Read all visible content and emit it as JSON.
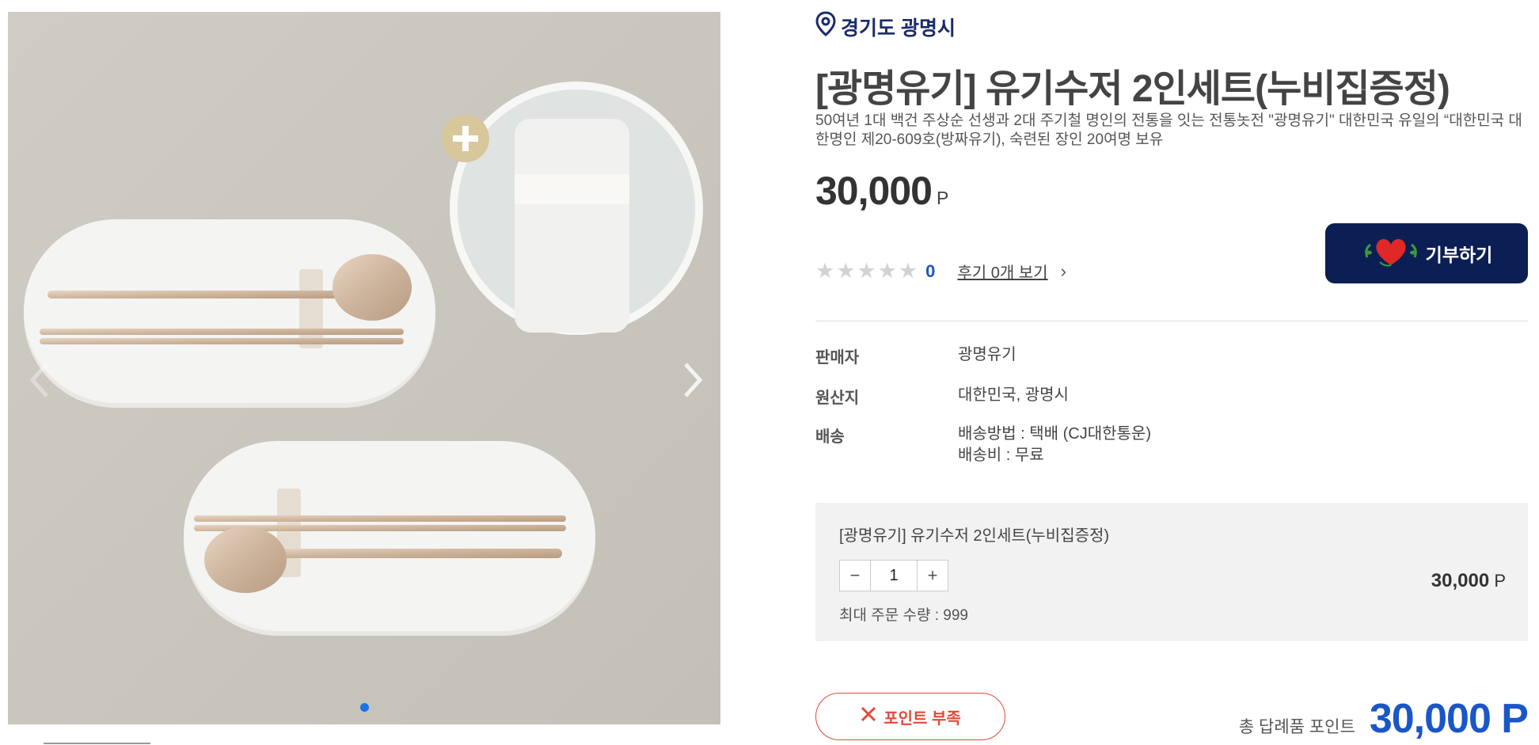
{
  "location": {
    "text": "경기도 광명시",
    "icon": "map-pin-icon"
  },
  "product": {
    "title": "[광명유기] 유기수저 2인세트(누비집증정)",
    "description": "50여년 1대 백건 주상순 선생과 2대 주기철 명인의 전통을 잇는 전통놋전 \"광명유기\" 대한민국 유일의 “대한민국 대한명인 제20-609호(방짜유기), 숙련된 장인 20여명 보유",
    "price": "30,000",
    "price_unit": "P"
  },
  "rating": {
    "stars_filled": 0,
    "stars_total": 5,
    "count": "0",
    "reviews_link": "후기 0개 보기"
  },
  "donate": {
    "label": "기부하기",
    "icon": "heart-icon"
  },
  "specs": {
    "seller": {
      "label": "판매자",
      "value": "광명유기"
    },
    "origin": {
      "label": "원산지",
      "value": "대한민국, 광명시"
    },
    "shipping": {
      "label": "배송",
      "method": "배송방법 : 택배 (CJ대한통운)",
      "fee": "배송비 : 무료"
    }
  },
  "option": {
    "name": "[광명유기] 유기수저 2인세트(누비집증정)",
    "quantity": "1",
    "minus": "−",
    "plus": "+",
    "price": "30,000",
    "price_unit": "P",
    "max_order": "최대 주문 수량 : 999"
  },
  "insufficient": {
    "label": "포인트 부족",
    "icon": "close-icon"
  },
  "total": {
    "label": "총 답례품 포인트",
    "value": "30,000 P"
  },
  "gallery": {
    "dot_count": 1,
    "active_dot": 0
  },
  "colors": {
    "navy": "#0c1f54",
    "blue": "#1a56c8",
    "red": "#e04a3a"
  }
}
